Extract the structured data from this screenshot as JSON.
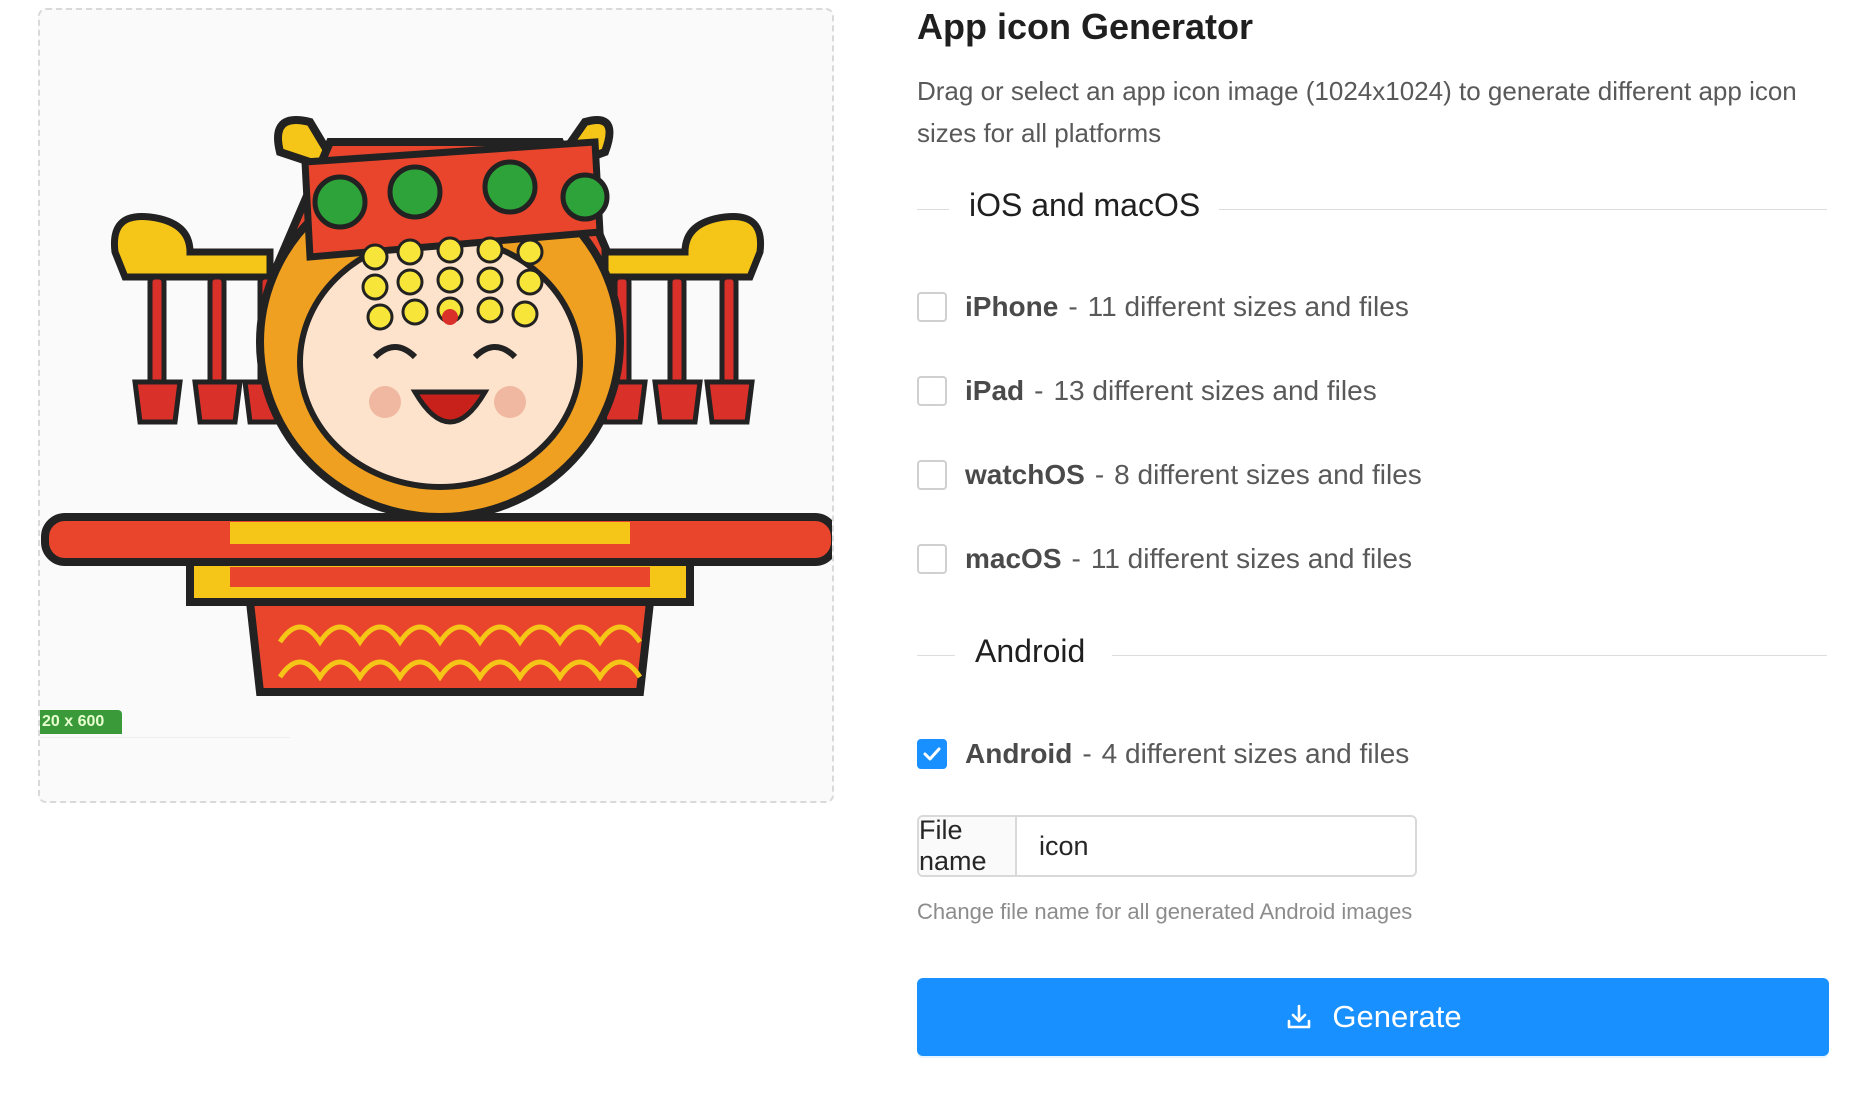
{
  "preview": {
    "size_tag": "20 x 600",
    "image_name": "app-icon-mascot"
  },
  "panel": {
    "title": "App icon Generator",
    "description": "Drag or select an app icon image (1024x1024) to generate different app icon sizes for all platforms"
  },
  "sections": {
    "ios": "iOS and macOS",
    "android": "Android"
  },
  "options": [
    {
      "name": "iPhone",
      "detail": "11 different sizes and files",
      "checked": false
    },
    {
      "name": "iPad",
      "detail": "13 different sizes and files",
      "checked": false
    },
    {
      "name": "watchOS",
      "detail": "8 different sizes and files",
      "checked": false
    },
    {
      "name": "macOS",
      "detail": "11 different sizes and files",
      "checked": false
    },
    {
      "name": "Android",
      "detail": "4 different sizes and files",
      "checked": true
    }
  ],
  "file_name": {
    "label": "File name",
    "value": "icon",
    "help": "Change file name for all generated Android images"
  },
  "generate_button": {
    "label": "Generate",
    "icon": "download-icon"
  },
  "colors": {
    "primary": "#1890ff",
    "border": "#d9d9d9"
  }
}
